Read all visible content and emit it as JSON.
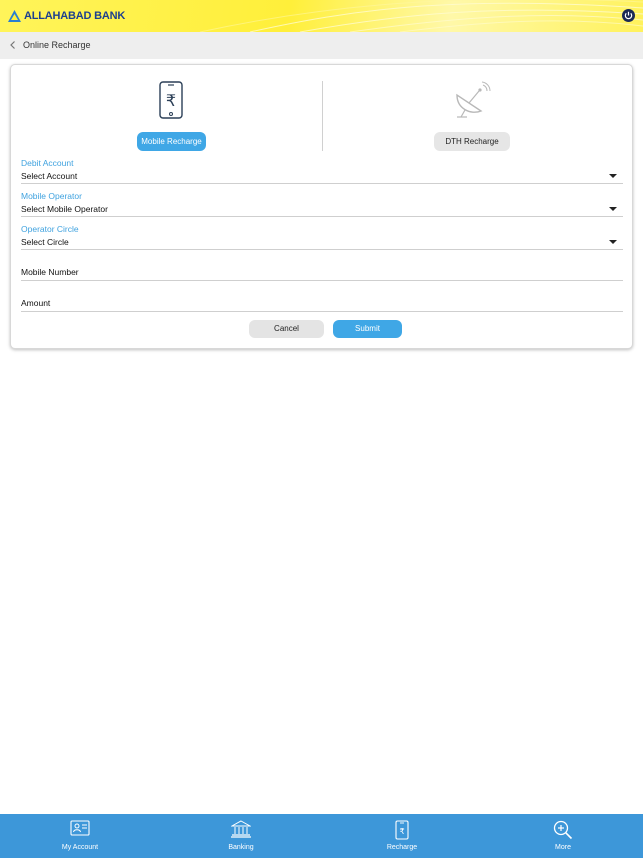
{
  "header": {
    "bank_name": "ALLAHABAD BANK",
    "power_icon": "power-icon",
    "brand_color": "#1d3f8f",
    "background_color": "#fff23c"
  },
  "breadcrumb": {
    "back_icon": "chevron-left-icon",
    "title": "Online Recharge"
  },
  "recharge_options": [
    {
      "label": "Mobile Recharge",
      "icon": "mobile-rupee-icon",
      "selected": true
    },
    {
      "label": "DTH Recharge",
      "icon": "satellite-dish-icon",
      "selected": false
    }
  ],
  "form": {
    "debit_account": {
      "label": "Debit Account",
      "value": "Select Account"
    },
    "mobile_operator": {
      "label": "Mobile Operator",
      "value": "Select Mobile Operator"
    },
    "operator_circle": {
      "label": "Operator Circle",
      "value": "Select Circle"
    },
    "mobile_number": {
      "placeholder": "Mobile Number"
    },
    "amount": {
      "placeholder": "Amount"
    },
    "cancel_label": "Cancel",
    "submit_label": "Submit"
  },
  "bottom_nav": [
    {
      "label": "My Account",
      "icon": "account-card-icon"
    },
    {
      "label": "Banking",
      "icon": "bank-building-icon"
    },
    {
      "label": "Recharge",
      "icon": "mobile-recharge-icon"
    },
    {
      "label": "More",
      "icon": "magnifier-plus-icon"
    }
  ],
  "colors": {
    "accent": "#3fa7e6",
    "nav_background": "#3d97d9",
    "label_blue": "#3fa2df"
  }
}
